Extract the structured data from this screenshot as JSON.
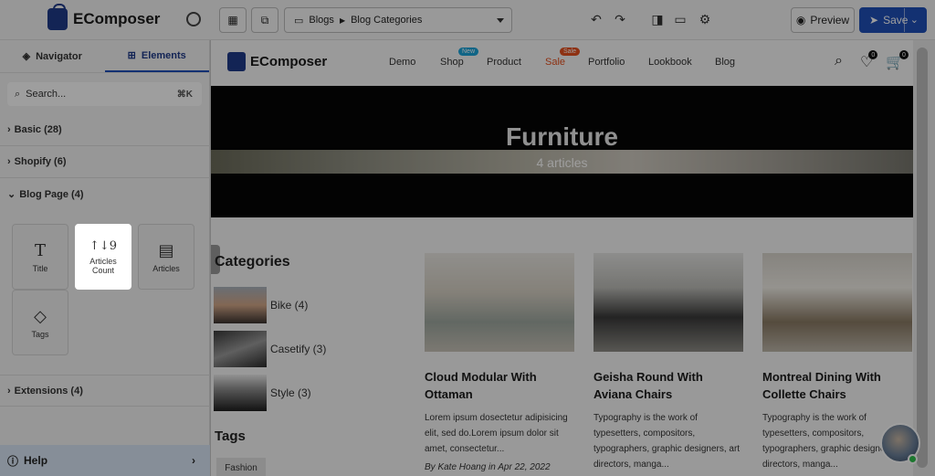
{
  "app": {
    "logo_text": "EComposer",
    "page_selector": {
      "blog": "Blogs",
      "page": "Blog Categories"
    },
    "preview_label": "Preview",
    "save_label": "Save"
  },
  "sidebar": {
    "tabs": [
      {
        "label": "Navigator"
      },
      {
        "label": "Elements"
      }
    ],
    "search_placeholder": "Search...",
    "search_shortcut": "⌘K",
    "sections": [
      {
        "label": "Basic (28)"
      },
      {
        "label": "Shopify (6)"
      },
      {
        "label": "Blog Page (4)"
      },
      {
        "label": "Extensions (4)"
      }
    ],
    "elements": [
      {
        "label": "Title",
        "icon": "T"
      },
      {
        "label": "Articles Count",
        "icon": "↑↓9"
      },
      {
        "label": "Articles",
        "icon": "▤"
      },
      {
        "label": "Tags",
        "icon": "◇"
      }
    ],
    "help_label": "Help"
  },
  "site": {
    "logo_text": "EComposer",
    "nav": [
      {
        "label": "Demo"
      },
      {
        "label": "Shop",
        "badge": "New"
      },
      {
        "label": "Product"
      },
      {
        "label": "Sale",
        "badge": "Sale"
      },
      {
        "label": "Portfolio"
      },
      {
        "label": "Lookbook"
      },
      {
        "label": "Blog"
      }
    ],
    "wishlist_count": "0",
    "cart_count": "0",
    "hero_title": "Furniture",
    "hero_subtitle": "4 articles",
    "categories_title": "Categories",
    "categories": [
      {
        "label": "Bike (4)"
      },
      {
        "label": "Casetify (3)"
      },
      {
        "label": "Style (3)"
      }
    ],
    "tags_title": "Tags",
    "tags": [
      {
        "label": "Fashion"
      }
    ],
    "articles": [
      {
        "title": "Cloud Modular With Ottaman",
        "excerpt": "Lorem ipsum dosectetur adipisicing elit, sed do.Lorem ipsum dolor sit amet, consectetur...",
        "meta": "By Kate Hoang  in Apr 22, 2022"
      },
      {
        "title": "Geisha Round With Aviana Chairs",
        "excerpt": "Typography is the work of typesetters, compositors, typographers, graphic designers, art directors, manga..."
      },
      {
        "title": "Montreal Dining With Collette Chairs",
        "excerpt": "Typography is the work of typesetters, compositors, typographers, graphic designers, art directors, manga..."
      }
    ]
  },
  "colors": {
    "brand": "#1f3a8a",
    "save": "#1f4fb8",
    "new_badge": "#1aa3d9",
    "sale": "#e5501e"
  }
}
